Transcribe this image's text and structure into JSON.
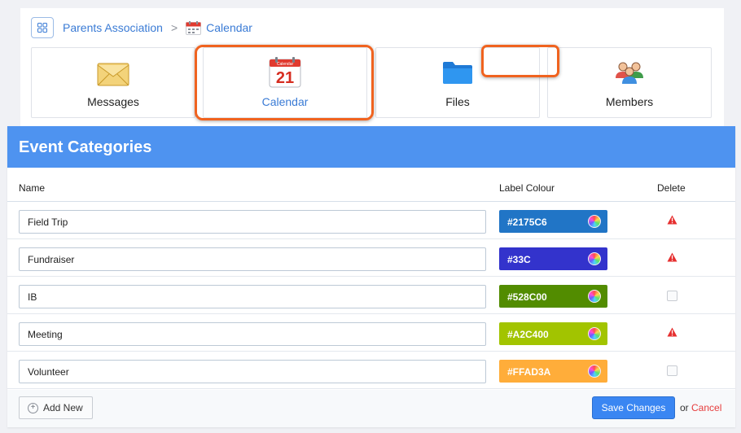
{
  "breadcrumb": {
    "root": "Parents Association",
    "separator": ">",
    "current": "Calendar"
  },
  "tiles": [
    {
      "label": "Messages",
      "icon": "envelope-icon"
    },
    {
      "label": "Calendar",
      "icon": "calendar-icon",
      "active": true
    },
    {
      "label": "Files",
      "icon": "folder-icon"
    },
    {
      "label": "Members",
      "icon": "members-icon"
    }
  ],
  "calendar_icon_text": {
    "month": "Calendar",
    "day": "21"
  },
  "card": {
    "title": "Event Categories",
    "columns": {
      "name": "Name",
      "colour": "Label Colour",
      "delete": "Delete"
    }
  },
  "categories": [
    {
      "name": "Field Trip",
      "colour": "#2175C6",
      "deletable": true
    },
    {
      "name": "Fundraiser",
      "colour": "#33C",
      "deletable": true
    },
    {
      "name": "IB",
      "colour": "#528C00",
      "deletable": false
    },
    {
      "name": "Meeting",
      "colour": "#A2C400",
      "deletable": true
    },
    {
      "name": "Volunteer",
      "colour": "#FFAD3A",
      "deletable": false
    }
  ],
  "footer": {
    "add_label": "Add New",
    "save_label": "Save Changes",
    "or_text": "or",
    "cancel_label": "Cancel"
  },
  "colors": {
    "header_blue": "#4E93F0",
    "link_blue": "#3A7BD5",
    "highlight_orange": "#F0631F",
    "warning_red": "#E62E2E"
  }
}
